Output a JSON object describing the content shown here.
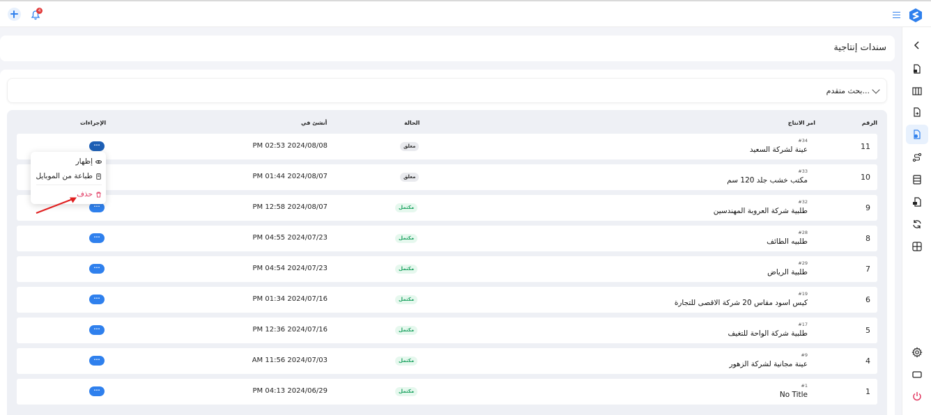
{
  "topbar": {
    "notification_count": "4"
  },
  "page": {
    "title": "سندات إنتاجية"
  },
  "search": {
    "label": "بحث متقدم..."
  },
  "table": {
    "headers": {
      "number": "الرقم",
      "order": "امر الانتاج",
      "status": "الحالة",
      "created": "أنشئ في",
      "actions": "الإجراءات"
    },
    "action_label": "···",
    "rows": [
      {
        "number": "11",
        "id": "#34",
        "name": "عينة لشركة السعيد",
        "status": "معلق",
        "status_kind": "pending",
        "date": "PM 02:53 2024/08/08"
      },
      {
        "number": "10",
        "id": "#33",
        "name": "مكتب خشب جلد 120 سم",
        "status": "معلق",
        "status_kind": "pending",
        "date": "PM 01:44 2024/08/07"
      },
      {
        "number": "9",
        "id": "#32",
        "name": "طلبية شركة العروبة المهندسين",
        "status": "مكتمل",
        "status_kind": "done",
        "date": "PM 12:58 2024/08/07"
      },
      {
        "number": "8",
        "id": "#28",
        "name": "طلبيه الطائف",
        "status": "مكتمل",
        "status_kind": "done",
        "date": "PM 04:55 2024/07/23"
      },
      {
        "number": "7",
        "id": "#29",
        "name": "طلبية الرياض",
        "status": "مكتمل",
        "status_kind": "done",
        "date": "PM 04:54 2024/07/23"
      },
      {
        "number": "6",
        "id": "#19",
        "name": "كيس اسود مقاس 20 شركة الاقصى للتجارة",
        "status": "مكتمل",
        "status_kind": "done",
        "date": "PM 01:34 2024/07/16"
      },
      {
        "number": "5",
        "id": "#17",
        "name": "طلبية شركة الواحة للتغيف",
        "status": "مكتمل",
        "status_kind": "done",
        "date": "PM 12:36 2024/07/16"
      },
      {
        "number": "4",
        "id": "#9",
        "name": "عينة مجانية لشركة الزهور",
        "status": "مكتمل",
        "status_kind": "done",
        "date": "AM 11:56 2024/07/03"
      },
      {
        "number": "1",
        "id": "#1",
        "name": "No Title",
        "status": "مكتمل",
        "status_kind": "done",
        "date": "PM 04:13 2024/06/29"
      }
    ]
  },
  "menu": {
    "show": "إظهار",
    "print_mobile": "طباعة من الموبايل",
    "delete": "حذف"
  },
  "sidebar": {
    "icons": [
      "chevron-left-icon",
      "file-lock-icon",
      "columns-icon",
      "file-export-icon",
      "file-check-icon",
      "truck-route-icon",
      "database-icon",
      "file-invoice-icon",
      "refresh-icon",
      "layout-grid-icon",
      "gear-icon",
      "rectangle-icon",
      "power-icon"
    ],
    "active_index": 4
  },
  "colors": {
    "accent": "#2f80ed",
    "danger": "#e0305a",
    "success": "#1fa362"
  }
}
